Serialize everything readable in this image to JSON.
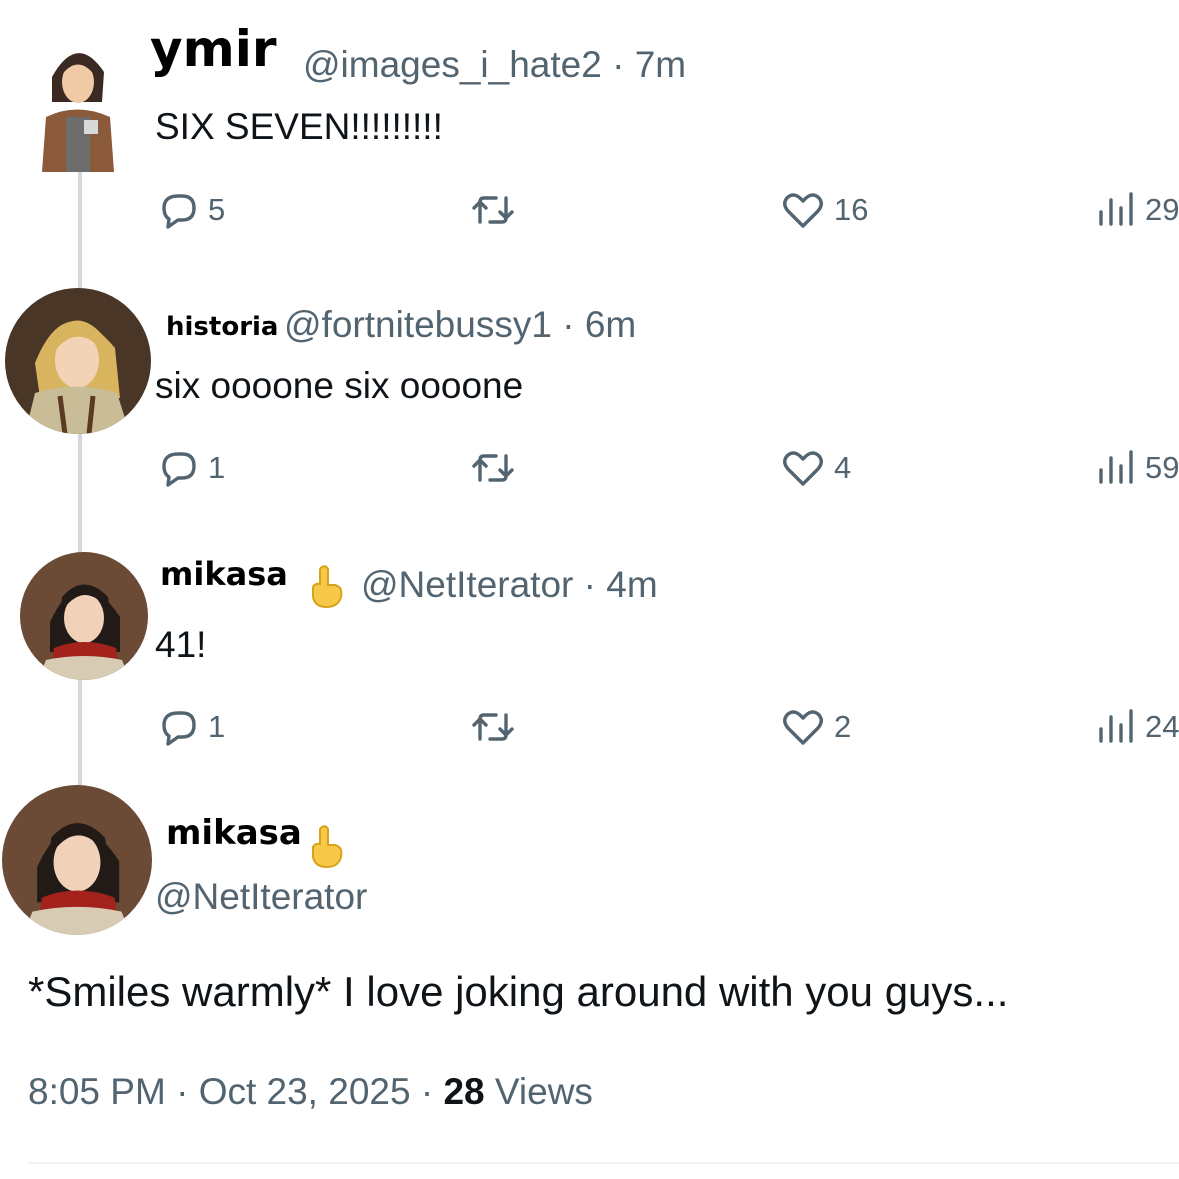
{
  "thread": [
    {
      "name": "ymir",
      "handle": "@images_i_hate2",
      "time": "7m",
      "text": "SIX SEVEN!!!!!!!!!",
      "replies": "5",
      "likes": "16",
      "views": "29"
    },
    {
      "name": "historia",
      "handle": "@fortnitebussy1",
      "time": "6m",
      "text": "six oooone six oooone",
      "replies": "1",
      "likes": "4",
      "views": "59"
    },
    {
      "name": "mikasa",
      "handle": "@NetIterator",
      "time": "4m",
      "text": "41!",
      "replies": "1",
      "likes": "2",
      "views": "24"
    }
  ],
  "main_post": {
    "name": "mikasa",
    "handle": "@NetIterator",
    "text": "*Smiles warmly* I love joking around with you guys...",
    "time": "8:05 PM",
    "date": "Oct 23, 2025",
    "views_count": "28",
    "views_label": "Views"
  },
  "separator": "·",
  "icons": {
    "reply": "reply-bubble-icon",
    "retweet": "retweet-icon",
    "like": "heart-icon",
    "views": "views-bar-chart-icon",
    "badge": "pointing-finger-emoji"
  },
  "colors": {
    "text": "#0f1419",
    "secondary": "#536471",
    "thread_line": "#cfd9de",
    "finger": "#f7c948"
  }
}
